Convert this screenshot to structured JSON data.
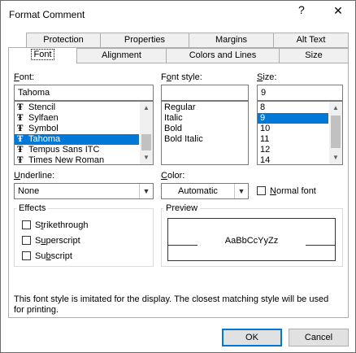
{
  "window": {
    "title": "Format Comment",
    "help": "?",
    "close": "✕"
  },
  "tabs_back": [
    "Protection",
    "Properties",
    "Margins",
    "Alt Text"
  ],
  "tabs_front": [
    "Font",
    "Alignment",
    "Colors and Lines",
    "Size"
  ],
  "font": {
    "label": "Font:",
    "value": "Tahoma",
    "items": [
      "Stencil",
      "Sylfaen",
      "Symbol",
      "Tahoma",
      "Tempus Sans ITC",
      "Times New Roman"
    ],
    "selected": "Tahoma"
  },
  "style": {
    "label": "Font style:",
    "value": "",
    "items": [
      "Regular",
      "Italic",
      "Bold",
      "Bold Italic"
    ]
  },
  "size": {
    "label": "Size:",
    "value": "9",
    "items": [
      "8",
      "9",
      "10",
      "11",
      "12",
      "14"
    ],
    "selected": "9"
  },
  "underline": {
    "label": "Underline:",
    "value": "None"
  },
  "color": {
    "label": "Color:",
    "value": "Automatic"
  },
  "normal_font": {
    "label": "Normal font",
    "checked": false
  },
  "effects": {
    "title": "Effects",
    "items": [
      {
        "label": "Strikethrough",
        "checked": false
      },
      {
        "label": "Superscript",
        "checked": false
      },
      {
        "label": "Subscript",
        "checked": false
      }
    ]
  },
  "preview": {
    "title": "Preview",
    "sample": "AaBbCcYyZz"
  },
  "note": "This font style is imitated for the display.  The closest matching style will be used for printing.",
  "buttons": {
    "ok": "OK",
    "cancel": "Cancel"
  },
  "icons": {
    "truetype": "truetype-font-icon",
    "scroll_up": "scroll-up-arrow-icon",
    "scroll_down": "scroll-down-arrow-icon",
    "dropdown": "chevron-down-icon"
  }
}
